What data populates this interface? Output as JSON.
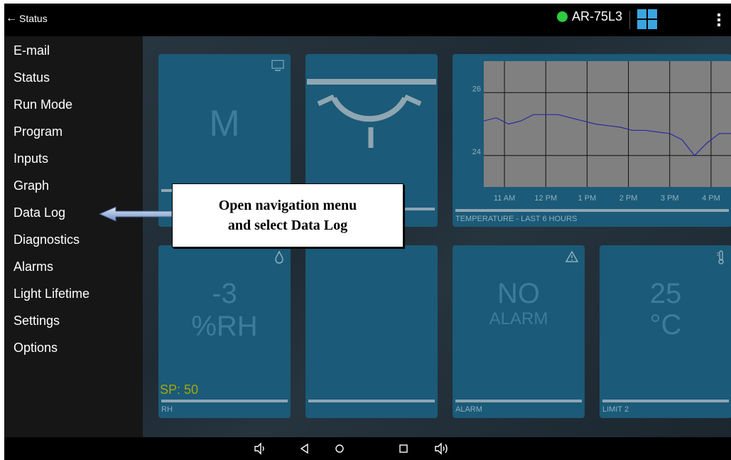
{
  "topbar": {
    "back_label": "Status",
    "device_name": "AR-75L3",
    "status_color": "#2ecc40"
  },
  "drawer": {
    "items": [
      "E-mail",
      "Status",
      "Run Mode",
      "Program",
      "Inputs",
      "Graph",
      "Data Log",
      "Diagnostics",
      "Alarms",
      "Light Lifetime",
      "Settings",
      "Options"
    ]
  },
  "tiles": {
    "mode": {
      "value": "M",
      "icon": "monitor-icon"
    },
    "light": {
      "icon": "light-fixture-icon"
    },
    "humidity": {
      "value": "-3",
      "unit": "%RH",
      "setpoint": "SP: 50",
      "label": "RH",
      "icon": "droplet-icon"
    },
    "alarm": {
      "value": "NO",
      "sub": "ALARM",
      "label": "ALARM",
      "icon": "alert-triangle-icon"
    },
    "limit": {
      "value": "25",
      "unit": "°C",
      "label": "LIMIT 2",
      "icon": "thermometer-icon"
    }
  },
  "chart_data": {
    "type": "line",
    "title": "TEMPERATURE - LAST 6 HOURS",
    "x_ticks": [
      "11 AM",
      "12 PM",
      "1 PM",
      "2 PM",
      "3 PM",
      "4 PM"
    ],
    "y_ticks": [
      "26",
      "24"
    ],
    "ylim": [
      23,
      27
    ],
    "grid": true,
    "series": [
      {
        "values": [
          25.1,
          25.2,
          25.0,
          25.1,
          25.3,
          25.3,
          25.3,
          25.2,
          25.1,
          25.0,
          24.95,
          24.9,
          24.8,
          24.8,
          24.75,
          24.7,
          24.5,
          24.0,
          24.4,
          24.7,
          24.7
        ]
      }
    ]
  },
  "callout": {
    "line1": "Open navigation menu",
    "line2": "and select Data Log"
  },
  "navbar": {
    "icons": [
      "volume-down-icon",
      "back-icon",
      "home-icon",
      "recents-icon",
      "volume-up-icon"
    ]
  }
}
